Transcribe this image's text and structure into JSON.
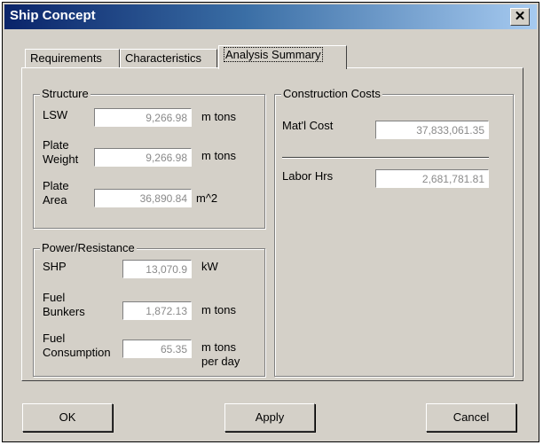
{
  "window": {
    "title": "Ship Concept",
    "close_glyph": "✕"
  },
  "tabs": [
    {
      "label": "Requirements"
    },
    {
      "label": "Characteristics"
    },
    {
      "label": "Analysis Summary",
      "active": true
    }
  ],
  "structure": {
    "title": "Structure",
    "lsw": {
      "label": "LSW",
      "value": "9,266.98",
      "unit": "m tons"
    },
    "plate_weight": {
      "label_line1": "Plate",
      "label_line2": "Weight",
      "value": "9,266.98",
      "unit": "m tons"
    },
    "plate_area": {
      "label_line1": "Plate",
      "label_line2": "Area",
      "value": "36,890.84",
      "unit": "m^2"
    }
  },
  "power": {
    "title": "Power/Resistance",
    "shp": {
      "label": "SHP",
      "value": "13,070.9",
      "unit": "kW"
    },
    "fuel_bunkers": {
      "label_line1": "Fuel",
      "label_line2": "Bunkers",
      "value": "1,872.13",
      "unit": "m tons"
    },
    "fuel_consumption": {
      "label_line1": "Fuel",
      "label_line2": "Consumption",
      "value": "65.35",
      "unit_line1": "m tons",
      "unit_line2": "per day"
    }
  },
  "costs": {
    "title": "Construction Costs",
    "matl_cost": {
      "label": "Mat'l Cost",
      "value": "37,833,061.35"
    },
    "labor_hrs": {
      "label": "Labor Hrs",
      "value": "2,681,781.81"
    }
  },
  "buttons": {
    "ok": "OK",
    "apply": "Apply",
    "cancel": "Cancel"
  }
}
